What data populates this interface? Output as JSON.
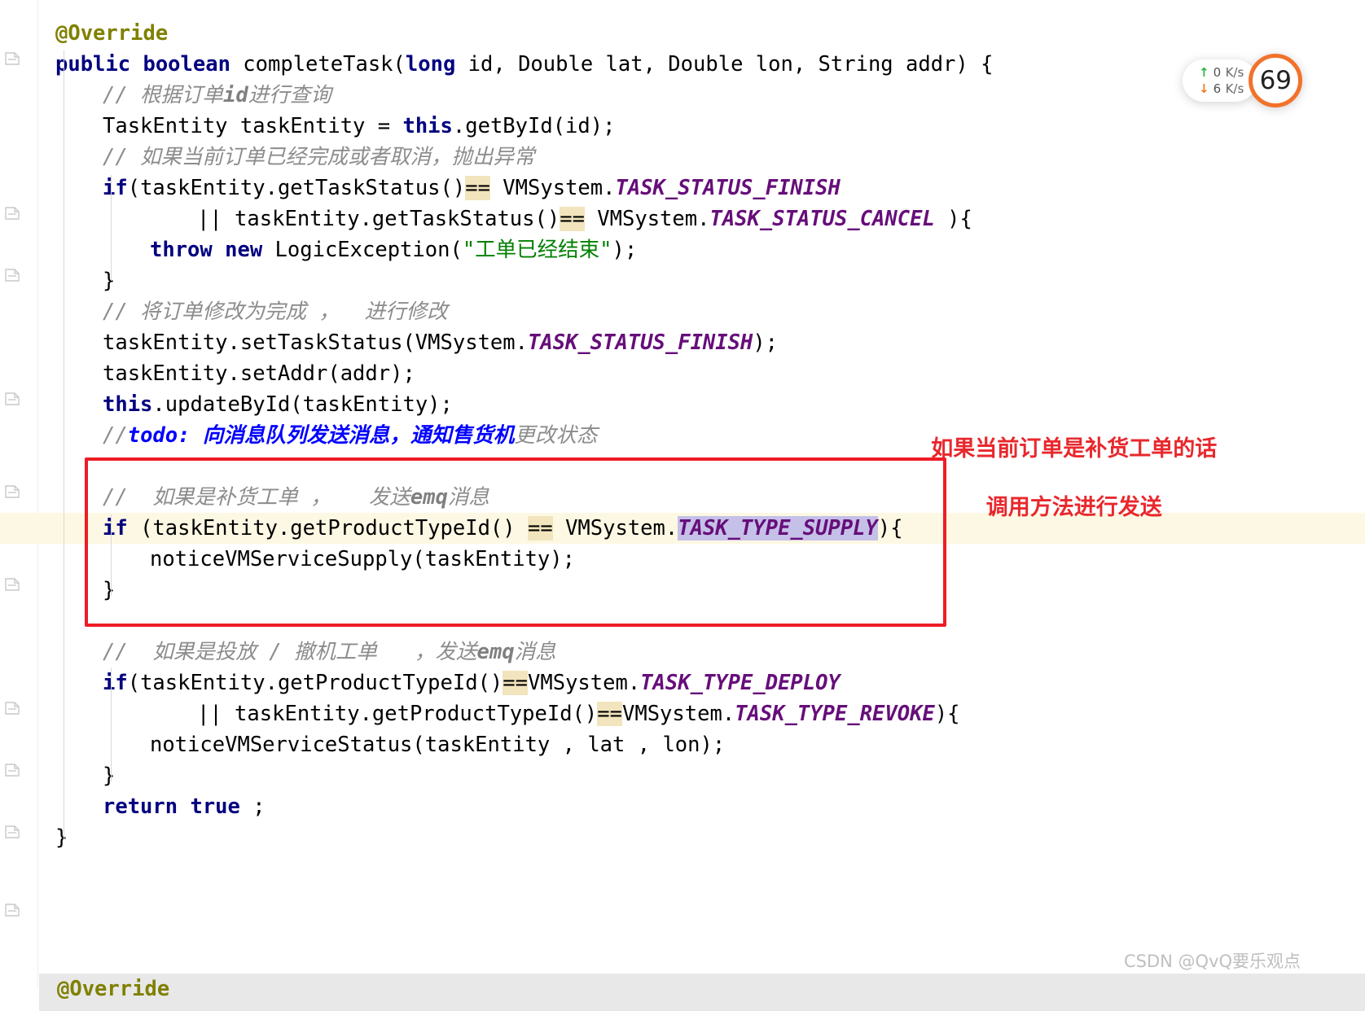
{
  "editor": {
    "language": "java",
    "code_lines": [
      {
        "indent": 0,
        "tokens": [
          {
            "t": "anno",
            "v": "@Override"
          }
        ]
      },
      {
        "indent": 0,
        "tokens": [
          {
            "t": "kw",
            "v": "public boolean "
          },
          {
            "t": "plain",
            "v": "completeTask("
          },
          {
            "t": "kw",
            "v": "long"
          },
          {
            "t": "plain",
            "v": " id, Double lat, Double lon, String addr) {"
          }
        ]
      },
      {
        "indent": 1,
        "tokens": [
          {
            "t": "cmt",
            "v": "// 根据订单"
          },
          {
            "t": "cmtb",
            "v": "id"
          },
          {
            "t": "cmt",
            "v": "进行查询"
          }
        ]
      },
      {
        "indent": 1,
        "tokens": [
          {
            "t": "plain",
            "v": "TaskEntity taskEntity = "
          },
          {
            "t": "kw",
            "v": "this"
          },
          {
            "t": "plain",
            "v": ".getById(id);"
          }
        ]
      },
      {
        "indent": 1,
        "tokens": [
          {
            "t": "cmt",
            "v": "// 如果当前订单已经完成或者取消，抛出异常"
          }
        ]
      },
      {
        "indent": 1,
        "tokens": [
          {
            "t": "kw",
            "v": "if"
          },
          {
            "t": "plain",
            "v": "(taskEntity.getTaskStatus()"
          },
          {
            "t": "ophl",
            "v": "=="
          },
          {
            "t": "plain",
            "v": " VMSystem."
          },
          {
            "t": "const",
            "v": "TASK_STATUS_FINISH"
          }
        ]
      },
      {
        "indent": 3,
        "tokens": [
          {
            "t": "plain",
            "v": "|| taskEntity.getTaskStatus()"
          },
          {
            "t": "ophl",
            "v": "=="
          },
          {
            "t": "plain",
            "v": " VMSystem."
          },
          {
            "t": "const",
            "v": "TASK_STATUS_CANCEL"
          },
          {
            "t": "plain",
            "v": " ){"
          }
        ]
      },
      {
        "indent": 2,
        "tokens": [
          {
            "t": "kw",
            "v": "throw new "
          },
          {
            "t": "plain",
            "v": "LogicException("
          },
          {
            "t": "str",
            "v": "\"工单已经结束\""
          },
          {
            "t": "plain",
            "v": ");"
          }
        ]
      },
      {
        "indent": 1,
        "tokens": [
          {
            "t": "plain",
            "v": "}"
          }
        ]
      },
      {
        "indent": 1,
        "tokens": [
          {
            "t": "cmt",
            "v": "// 将订单修改为完成 ，  进行修改"
          }
        ]
      },
      {
        "indent": 1,
        "tokens": [
          {
            "t": "plain",
            "v": "taskEntity.setTaskStatus(VMSystem."
          },
          {
            "t": "const",
            "v": "TASK_STATUS_FINISH"
          },
          {
            "t": "plain",
            "v": ");"
          }
        ]
      },
      {
        "indent": 1,
        "tokens": [
          {
            "t": "plain",
            "v": "taskEntity.setAddr(addr);"
          }
        ]
      },
      {
        "indent": 1,
        "tokens": [
          {
            "t": "kw",
            "v": "this"
          },
          {
            "t": "plain",
            "v": ".updateById(taskEntity);"
          }
        ]
      },
      {
        "indent": 1,
        "tokens": [
          {
            "t": "cmt",
            "v": "//"
          },
          {
            "t": "todo",
            "v": "todo: 向消息队列发送消息，通知售货机"
          },
          {
            "t": "cmt",
            "v": "更改状态"
          }
        ]
      },
      {
        "indent": 1,
        "tokens": [
          {
            "t": "plain",
            "v": ""
          }
        ]
      },
      {
        "indent": 1,
        "tokens": [
          {
            "t": "cmt",
            "v": "//  如果是补货工单 ，   发送"
          },
          {
            "t": "cmtb",
            "v": "emq"
          },
          {
            "t": "cmt",
            "v": "消息"
          }
        ]
      },
      {
        "indent": 1,
        "highlight": "current",
        "tokens": [
          {
            "t": "kw",
            "v": "if"
          },
          {
            "t": "plain",
            "v": " (taskEntity.getProductTypeId() "
          },
          {
            "t": "ophl",
            "v": "=="
          },
          {
            "t": "plain",
            "v": " VMSystem."
          },
          {
            "t": "sel",
            "v": "TASK_TYPE_SUPPLY"
          },
          {
            "t": "plain",
            "v": "){"
          }
        ]
      },
      {
        "indent": 2,
        "tokens": [
          {
            "t": "plain",
            "v": "noticeVMServiceSupply(taskEntity);"
          }
        ]
      },
      {
        "indent": 1,
        "tokens": [
          {
            "t": "plain",
            "v": "}"
          }
        ]
      },
      {
        "indent": 1,
        "tokens": [
          {
            "t": "plain",
            "v": ""
          }
        ]
      },
      {
        "indent": 1,
        "tokens": [
          {
            "t": "cmt",
            "v": "//  如果是投放 / 撤机工单   ，发送"
          },
          {
            "t": "cmtb",
            "v": "emq"
          },
          {
            "t": "cmt",
            "v": "消息"
          }
        ]
      },
      {
        "indent": 1,
        "tokens": [
          {
            "t": "kw",
            "v": "if"
          },
          {
            "t": "plain",
            "v": "(taskEntity.getProductTypeId()"
          },
          {
            "t": "ophl",
            "v": "=="
          },
          {
            "t": "plain",
            "v": "VMSystem."
          },
          {
            "t": "const",
            "v": "TASK_TYPE_DEPLOY"
          }
        ]
      },
      {
        "indent": 3,
        "tokens": [
          {
            "t": "plain",
            "v": "|| taskEntity.getProductTypeId()"
          },
          {
            "t": "ophl",
            "v": "=="
          },
          {
            "t": "plain",
            "v": "VMSystem."
          },
          {
            "t": "const",
            "v": "TASK_TYPE_REVOKE"
          },
          {
            "t": "plain",
            "v": "){"
          }
        ]
      },
      {
        "indent": 2,
        "tokens": [
          {
            "t": "plain",
            "v": "noticeVMServiceStatus(taskEntity , lat , lon);"
          }
        ]
      },
      {
        "indent": 1,
        "tokens": [
          {
            "t": "plain",
            "v": "}"
          }
        ]
      },
      {
        "indent": 1,
        "tokens": [
          {
            "t": "kw",
            "v": "return true "
          },
          {
            "t": "plain",
            "v": ";"
          }
        ]
      },
      {
        "indent": 0,
        "tokens": [
          {
            "t": "plain",
            "v": "}"
          }
        ]
      }
    ],
    "bottom_partial_line": "@Override",
    "gutter": {
      "bulb_icon": "lightbulb-icon",
      "fold_icon": "code-fold-icon"
    }
  },
  "annotation": {
    "box_color": "#ee1c25",
    "text_color": "#e8282d",
    "line1": "如果当前订单是补货工单的话",
    "line2": "调用方法进行发送"
  },
  "network_widget": {
    "upload_arrow": "arrow-up-icon",
    "upload_value": "0",
    "upload_unit": "K/s",
    "download_arrow": "arrow-down-icon",
    "download_value": "6",
    "download_unit": "K/s",
    "gauge_value": "69",
    "gauge_color": "#f2722b"
  },
  "watermark": {
    "text": "CSDN @QvQ要乐观点"
  },
  "colors": {
    "keyword": "#000080",
    "annotation_token": "#808000",
    "comment": "#8c8c8c",
    "todo": "#0000ff",
    "string": "#008000",
    "constant": "#660e7a",
    "operator_highlight_bg": "#f2e4bd",
    "selection_bg": "#c5c0e8",
    "current_line_bg": "#fdf8e3"
  }
}
